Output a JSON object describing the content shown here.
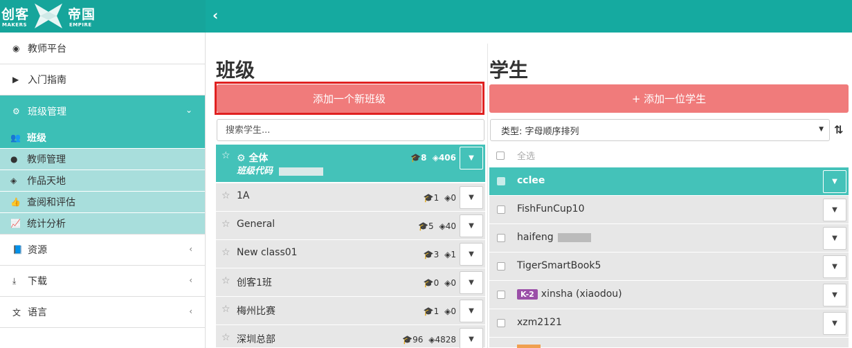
{
  "logo": {
    "cn_left": "创客",
    "cn_right": "帝国",
    "en_left": "MAKERS",
    "en_right": "EMPIRE"
  },
  "icons": {
    "collapse": "chevron-left-icon",
    "sort": "sort-alpha-icon"
  },
  "colors": {
    "brand": "#15aaa0",
    "active": "#3cbfb6",
    "sub_bg": "#a8dedc",
    "accent": "#f07b7b",
    "badge": "#9b4fa8"
  },
  "sidebar": {
    "items": [
      {
        "label": "教师平台",
        "icon": "dashboard-icon"
      },
      {
        "label": "入门指南",
        "icon": "play-icon"
      },
      {
        "label": "班级管理",
        "icon": "gear-icon"
      },
      {
        "label": "资源",
        "icon": "book-icon"
      },
      {
        "label": "下载",
        "icon": "download-icon"
      },
      {
        "label": "语言",
        "icon": "translate-icon"
      }
    ],
    "sub_items": [
      {
        "label": "班级",
        "icon": "users-icon"
      },
      {
        "label": "教师管理",
        "icon": "user-icon"
      },
      {
        "label": "作品天地",
        "icon": "cube-icon"
      },
      {
        "label": "查阅和评估",
        "icon": "thumbs-up-icon"
      },
      {
        "label": "统计分析",
        "icon": "line-chart-icon"
      }
    ]
  },
  "classes": {
    "title": "班级",
    "add_button": "添加一个新班级",
    "search_placeholder": "搜索学生...",
    "all": {
      "name": "全体",
      "code_label": "班级代码",
      "students": "8",
      "projects": "406"
    },
    "rows": [
      {
        "name": "1A",
        "students": "1",
        "projects": "0"
      },
      {
        "name": "General",
        "students": "5",
        "projects": "40"
      },
      {
        "name": "New class01",
        "students": "3",
        "projects": "1"
      },
      {
        "name": "创客1班",
        "students": "0",
        "projects": "0"
      },
      {
        "name": "梅州比赛",
        "students": "1",
        "projects": "0"
      },
      {
        "name": "深圳总部",
        "students": "96",
        "projects": "4828"
      }
    ]
  },
  "students": {
    "title": "学生",
    "add_button": "+ 添加一位学生",
    "sort_label": "类型: 字母顺序排列",
    "select_all": "全选",
    "rows": [
      {
        "name": "cclee",
        "badge": ""
      },
      {
        "name": "FishFunCup10",
        "badge": ""
      },
      {
        "name": "haifeng",
        "badge": ""
      },
      {
        "name": "TigerSmartBook5",
        "badge": ""
      },
      {
        "name": "xinsha (xiaodou)",
        "badge": "K-2"
      },
      {
        "name": "xzm2121",
        "badge": ""
      }
    ]
  }
}
